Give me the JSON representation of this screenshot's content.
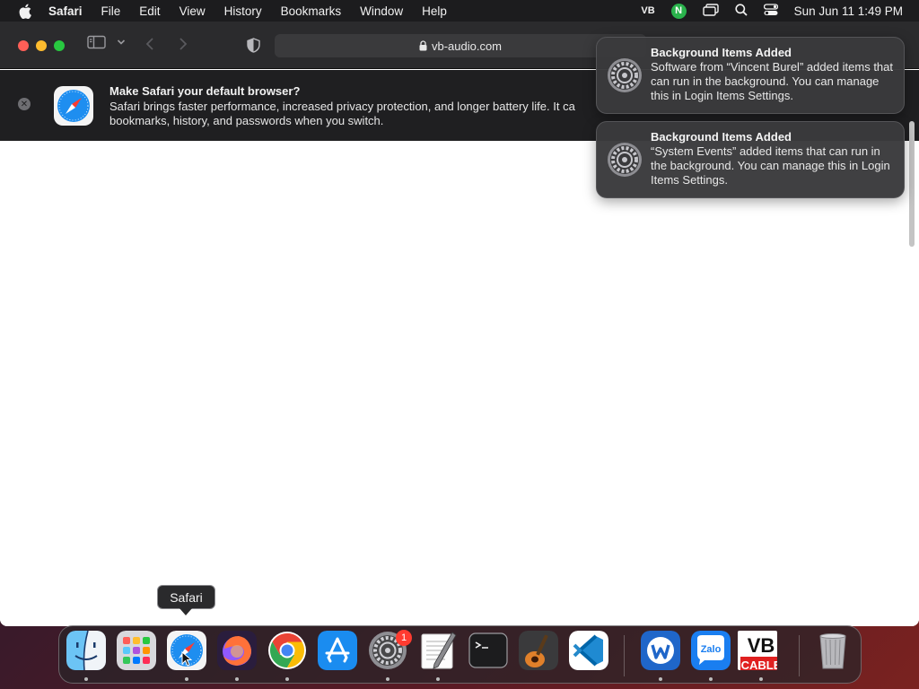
{
  "menubar": {
    "app_name": "Safari",
    "items": [
      "File",
      "Edit",
      "View",
      "History",
      "Bookmarks",
      "Window",
      "Help"
    ],
    "status_vb": "VB",
    "status_n": "N",
    "clock": "Sun Jun 11  1:49 PM"
  },
  "toolbar": {
    "url": "vb-audio.com"
  },
  "banner": {
    "title": "Make Safari your default browser?",
    "line1": "Safari brings faster performance, increased privacy protection, and longer battery life. It ca",
    "line2": "bookmarks, history, and passwords when you switch."
  },
  "notifications": [
    {
      "title": "Background Items Added",
      "body": "Software from “Vincent Burel” added items that can run in the background. You can manage this in Login Items Settings."
    },
    {
      "title": "Background Items Added",
      "body": "“System Events” added items that can run in the background. You can manage this in Login Items Settings."
    }
  ],
  "dock": {
    "tooltip": "Safari",
    "settings_badge": "1",
    "items": [
      "finder",
      "launchpad",
      "safari",
      "firefox",
      "chrome",
      "app-store",
      "system-settings",
      "textedit",
      "terminal",
      "garageband",
      "vscode",
      "webex",
      "zalo",
      "vb-cable",
      "trash"
    ],
    "zalo_label": "Zalo",
    "vb_cable_top": "VB",
    "vb_cable_bottom": "CABLE"
  },
  "colors": {
    "close": "#fe5f57",
    "minimize": "#febc2e",
    "maximize": "#28c840",
    "badge": "#ff3b30"
  }
}
